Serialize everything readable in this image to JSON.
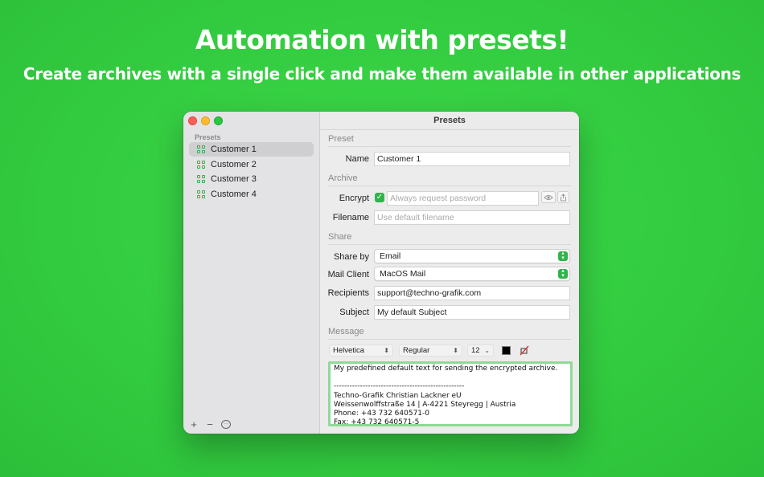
{
  "hero": {
    "title": "Automation with presets!",
    "subtitle": "Create archives with a single click and make them available in other applications"
  },
  "window": {
    "title": "Presets"
  },
  "sidebar": {
    "section": "Presets",
    "items": [
      {
        "label": "Customer 1",
        "selected": true
      },
      {
        "label": "Customer 2",
        "selected": false
      },
      {
        "label": "Customer 3",
        "selected": false
      },
      {
        "label": "Customer 4",
        "selected": false
      }
    ],
    "footer": {
      "add": "+",
      "remove": "−",
      "more": "···"
    }
  },
  "preset": {
    "section": "Preset",
    "name_label": "Name",
    "name_value": "Customer 1"
  },
  "archive": {
    "section": "Archive",
    "encrypt_label": "Encrypt",
    "encrypt_checked": true,
    "password_placeholder": "Always request password",
    "filename_label": "Filename",
    "filename_placeholder": "Use default filename"
  },
  "share": {
    "section": "Share",
    "share_by_label": "Share by",
    "share_by_value": "Email",
    "mail_client_label": "Mail Client",
    "mail_client_value": "MacOS Mail",
    "recipients_label": "Recipients",
    "recipients_value": "support@techno-grafik.com",
    "subject_label": "Subject",
    "subject_value": "My default Subject"
  },
  "message": {
    "section": "Message",
    "font_family": "Helvetica",
    "font_style": "Regular",
    "font_size": "12",
    "text_color": "#000000",
    "lines": [
      "My predefined default text for sending the encrypted archive.",
      "",
      "--------------------------------------------------",
      "Techno-Grafik Christian Lackner eU",
      "Weissenwolffstraße 14 | A-4221 Steyregg | Austria",
      "Phone: +43 732 640571-0",
      "Fax: +43 732 640571-5"
    ]
  },
  "colors": {
    "background": "#33cc40",
    "accent": "#2fb44a",
    "focus_ring": "#8fd996"
  }
}
